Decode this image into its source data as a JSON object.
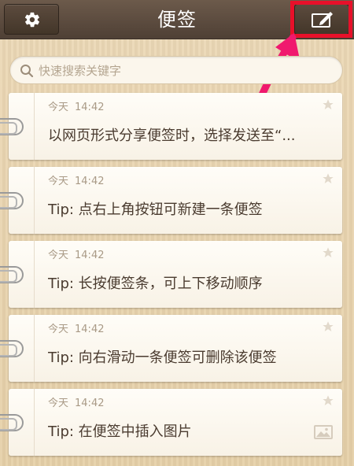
{
  "header": {
    "title": "便签",
    "settings_icon": "gear-icon",
    "new_note_icon": "edit-icon",
    "highlight_color": "#e8102a"
  },
  "search": {
    "placeholder": "快速搜索关键字",
    "value": "",
    "icon": "search-icon"
  },
  "notes": [
    {
      "day": "今天",
      "time": "14:42",
      "text": "以网页形式分享便签时，选择发送至“...",
      "has_image": false
    },
    {
      "day": "今天",
      "time": "14:42",
      "text": "Tip: 点右上角按钮可新建一条便签",
      "has_image": false
    },
    {
      "day": "今天",
      "time": "14:42",
      "text": "Tip: 长按便签条，可上下移动顺序",
      "has_image": false
    },
    {
      "day": "今天",
      "time": "14:42",
      "text": "Tip: 向右滑动一条便签可删除该便签",
      "has_image": false
    },
    {
      "day": "今天",
      "time": "14:42",
      "text": "Tip: 在便签中插入图片",
      "has_image": true
    }
  ]
}
